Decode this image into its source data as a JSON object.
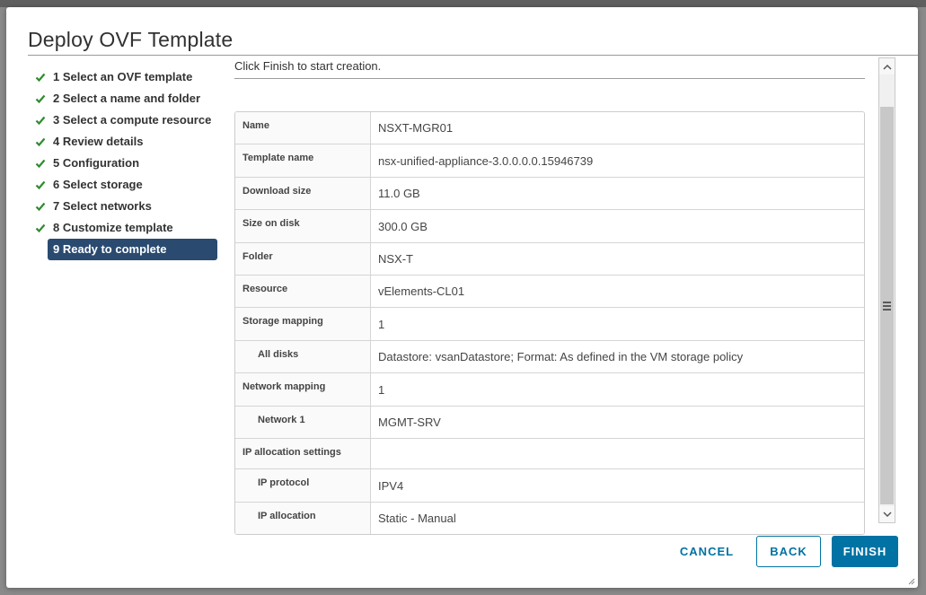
{
  "dialog": {
    "title": "Deploy OVF Template"
  },
  "steps": [
    {
      "label": "1 Select an OVF template",
      "done": true
    },
    {
      "label": "2 Select a name and folder",
      "done": true
    },
    {
      "label": "3 Select a compute resource",
      "done": true
    },
    {
      "label": "4 Review details",
      "done": true
    },
    {
      "label": "5 Configuration",
      "done": true
    },
    {
      "label": "6 Select storage",
      "done": true
    },
    {
      "label": "7 Select networks",
      "done": true
    },
    {
      "label": "8 Customize template",
      "done": true
    },
    {
      "label": "9 Ready to complete",
      "active": true
    }
  ],
  "content": {
    "intro": "Click Finish to start creation.",
    "details": [
      {
        "key": "Name",
        "value": "NSXT-MGR01"
      },
      {
        "key": "Template name",
        "value": "nsx-unified-appliance-3.0.0.0.0.15946739"
      },
      {
        "key": "Download size",
        "value": "11.0 GB"
      },
      {
        "key": "Size on disk",
        "value": "300.0 GB"
      },
      {
        "key": "Folder",
        "value": "NSX-T"
      },
      {
        "key": "Resource",
        "value": "vElements-CL01"
      },
      {
        "key": "Storage mapping",
        "value": "1"
      },
      {
        "key": "All disks",
        "value": "Datastore: vsanDatastore; Format: As defined in the VM storage policy",
        "indent": true
      },
      {
        "key": "Network mapping",
        "value": "1"
      },
      {
        "key": "Network 1",
        "value": "MGMT-SRV",
        "indent": true
      },
      {
        "key": "IP allocation settings",
        "value": ""
      },
      {
        "key": "IP protocol",
        "value": "IPV4",
        "indent": true
      },
      {
        "key": "IP allocation",
        "value": "Static - Manual",
        "indent": true
      }
    ]
  },
  "buttons": {
    "cancel": "CANCEL",
    "back": "BACK",
    "finish": "FINISH"
  },
  "icons": {
    "check": "check-icon",
    "scroll_up": "chevron-up-icon",
    "scroll_down": "chevron-down-icon",
    "resize": "resize-grip-icon"
  },
  "colors": {
    "accent": "#0072a3",
    "active_step": "#2a4a70",
    "check": "#2e8b2e"
  }
}
